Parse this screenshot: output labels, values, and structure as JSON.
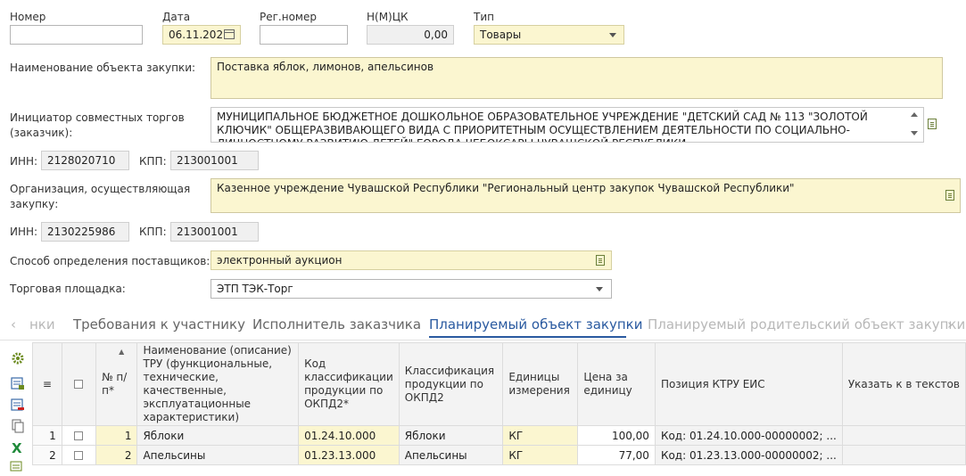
{
  "header": {
    "nomer_label": "Номер",
    "nomer_value": "",
    "data_label": "Дата",
    "data_value": "06.11.202",
    "regnomer_label": "Рег.номер",
    "regnomer_value": "",
    "nmck_label": "Н(М)ЦК",
    "nmck_value": "0,00",
    "tip_label": "Тип",
    "tip_value": "Товары"
  },
  "form": {
    "object_label": "Наименование объекта закупки:",
    "object_value": "Поставка яблок, лимонов, апельсинов",
    "initiator_label": "Инициатор совместных торгов (заказчик):",
    "initiator_value": "МУНИЦИПАЛЬНОЕ БЮДЖЕТНОЕ ДОШКОЛЬНОЕ ОБРАЗОВАТЕЛЬНОЕ УЧРЕЖДЕНИЕ \"ДЕТСКИЙ САД № 113 \"ЗОЛОТОЙ КЛЮЧИК\" ОБЩЕРАЗВИВАЮЩЕГО ВИДА С ПРИОРИТЕТНЫМ ОСУЩЕСТВЛЕНИЕМ ДЕЯТЕЛЬНОСТИ ПО СОЦИАЛЬНО-ЛИЧНОСТНОМУ РАЗВИТИЮ ДЕТЕЙ\" ГОРОДА ЧЕБОКСАРЫ ЧУВАШСКОЙ РЕСПУБЛИКИ",
    "inn_label": "ИНН:",
    "kpp_label": "КПП:",
    "initiator_inn": "2128020710",
    "initiator_kpp": "213001001",
    "org_label": "Организация, осуществляющая закупку:",
    "org_value": "Казенное  учреждение Чувашской Республики \"Региональный центр закупок Чувашской Республики\"",
    "org_inn": "2130225986",
    "org_kpp": "213001001",
    "method_label": "Способ определения поставщиков:",
    "method_value": "электронный аукцион",
    "platform_label": "Торговая площадка:",
    "platform_value": "ЭТП ТЭК-Торг"
  },
  "tabs": {
    "prev": "нки",
    "t1": "Требования к участнику",
    "t2": "Исполнитель заказчика",
    "t3": "Планируемый объект закупки",
    "t4": "Планируемый родительский объект закупки"
  },
  "table": {
    "columns": {
      "num": "№ п/п*",
      "name": "Наименование (описание) ТРУ (функциональные, технические, качественные, эксплуатационные характеристики)",
      "okpd_code": "Код классификации продукции по ОКПД2*",
      "okpd_class": "Классификация продукции по ОКПД2",
      "units": "Единицы измерения",
      "price": "Цена за единицу",
      "ktru": "Позиция КТРУ ЕИС",
      "text": "Указать к в текстов"
    },
    "rows": [
      {
        "idx": "1",
        "num": "1",
        "name": "Яблоки",
        "okpd_code": "01.24.10.000",
        "okpd_class": "Яблоки",
        "units": "КГ",
        "price": "100,00",
        "ktru": "Код: 01.24.10.000-00000002; ..."
      },
      {
        "idx": "2",
        "num": "2",
        "name": "Апельсины",
        "okpd_code": "01.23.13.000",
        "okpd_class": "Апельсины",
        "units": "КГ",
        "price": "77,00",
        "ktru": "Код: 01.23.13.000-00000002; ..."
      }
    ]
  },
  "colors": {
    "accent": "#2a5aa0",
    "field_yellow": "#fbf6d0",
    "icon_green": "#6b8a1f"
  }
}
